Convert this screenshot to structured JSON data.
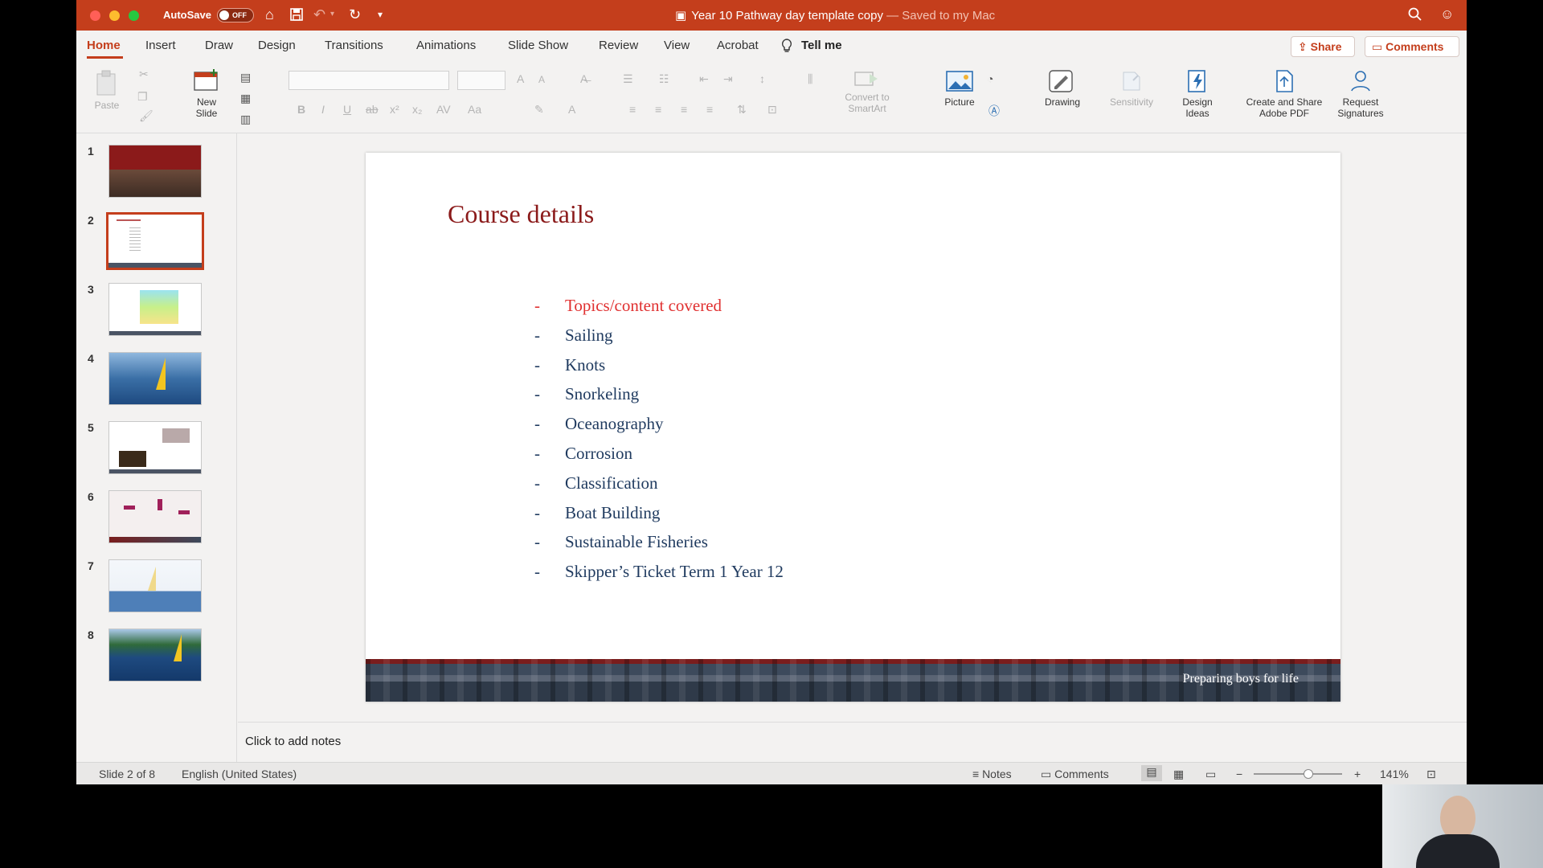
{
  "titlebar": {
    "autosave_label": "AutoSave",
    "autosave_state": "OFF",
    "doc_name": "Year 10 Pathway day template copy",
    "saved_status": "— Saved to my Mac"
  },
  "tabs": [
    {
      "label": "Home",
      "active": true
    },
    {
      "label": "Insert"
    },
    {
      "label": "Draw"
    },
    {
      "label": "Design"
    },
    {
      "label": "Transitions"
    },
    {
      "label": "Animations"
    },
    {
      "label": "Slide Show"
    },
    {
      "label": "Review"
    },
    {
      "label": "View"
    },
    {
      "label": "Acrobat"
    },
    {
      "label": "Tell me"
    }
  ],
  "share": {
    "share_label": "Share",
    "comments_label": "Comments"
  },
  "ribbon": {
    "paste": "Paste",
    "new_slide": "New",
    "new_slide_2": "Slide",
    "convert_smartart": "Convert to",
    "convert_smartart_2": "SmartArt",
    "picture": "Picture",
    "drawing": "Drawing",
    "sensitivity": "Sensitivity",
    "design_ideas": "Design",
    "design_ideas_2": "Ideas",
    "create_share_pdf": "Create and Share",
    "create_share_pdf_2": "Adobe PDF",
    "request_signatures": "Request",
    "request_signatures_2": "Signatures"
  },
  "thumbnails": [
    {
      "num": "1"
    },
    {
      "num": "2",
      "selected": true
    },
    {
      "num": "3"
    },
    {
      "num": "4"
    },
    {
      "num": "5"
    },
    {
      "num": "6"
    },
    {
      "num": "7"
    },
    {
      "num": "8"
    }
  ],
  "slide": {
    "title": "Course details",
    "bullets": [
      {
        "text": "Topics/content covered",
        "highlight": true
      },
      {
        "text": "Sailing"
      },
      {
        "text": "Knots"
      },
      {
        "text": "Snorkeling"
      },
      {
        "text": "Oceanography"
      },
      {
        "text": "Corrosion"
      },
      {
        "text": "Classification"
      },
      {
        "text": "Boat Building"
      },
      {
        "text": "Sustainable Fisheries"
      },
      {
        "text": "Skipper’s Ticket Term 1 Year 12"
      }
    ],
    "bullet_marker": "-",
    "footer_tagline": "Preparing boys for life"
  },
  "notes_placeholder": "Click to add notes",
  "statusbar": {
    "slide_indicator": "Slide 2 of 8",
    "language": "English (United States)",
    "notes_label": "Notes",
    "comments_label": "Comments",
    "zoom": "141%"
  },
  "colors": {
    "accent": "#c43e1c",
    "title_red": "#8b1a1a",
    "bullet_navy": "#1f3a5f",
    "highlight_red": "#e03030"
  }
}
